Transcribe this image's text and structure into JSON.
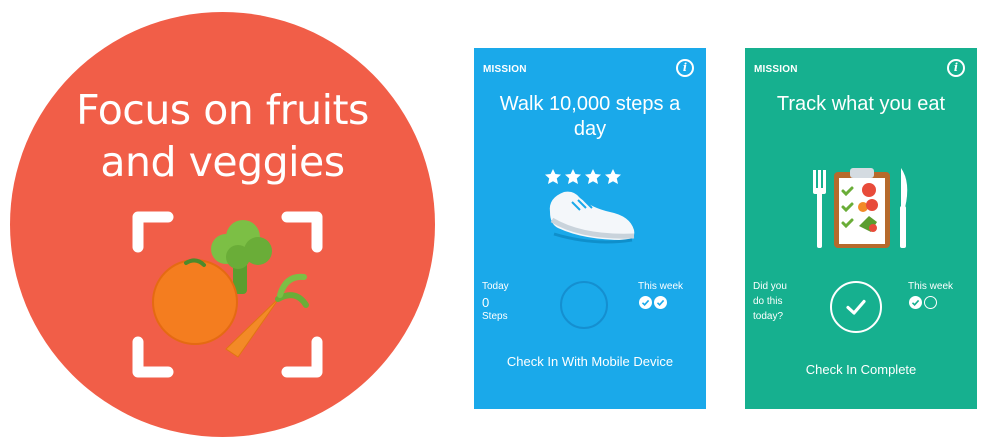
{
  "promo": {
    "title_line1": "Focus on fruits",
    "title_line2": "and veggies",
    "icon": "fruit-veggie-scan-icon",
    "color": "#f15e48"
  },
  "cards": [
    {
      "label": "MISSION",
      "title": "Walk 10,000 steps a day",
      "icon": "running-shoe-icon",
      "stars": 4,
      "today_label": "Today",
      "today_value": "0",
      "today_unit": "Steps",
      "week_label": "This week",
      "week_checked": 2,
      "week_total": 2,
      "cta": "Check In With Mobile Device",
      "color": "#1aa9ea"
    },
    {
      "label": "MISSION",
      "title": "Track what you eat",
      "icon": "food-log-clipboard-icon",
      "question_line1": "Did you",
      "question_line2": "do this",
      "question_line3": "today?",
      "week_label": "This week",
      "week_checked": 1,
      "week_total": 2,
      "cta": "Check In Complete",
      "status": "checked-in",
      "color": "#16b08f"
    }
  ]
}
